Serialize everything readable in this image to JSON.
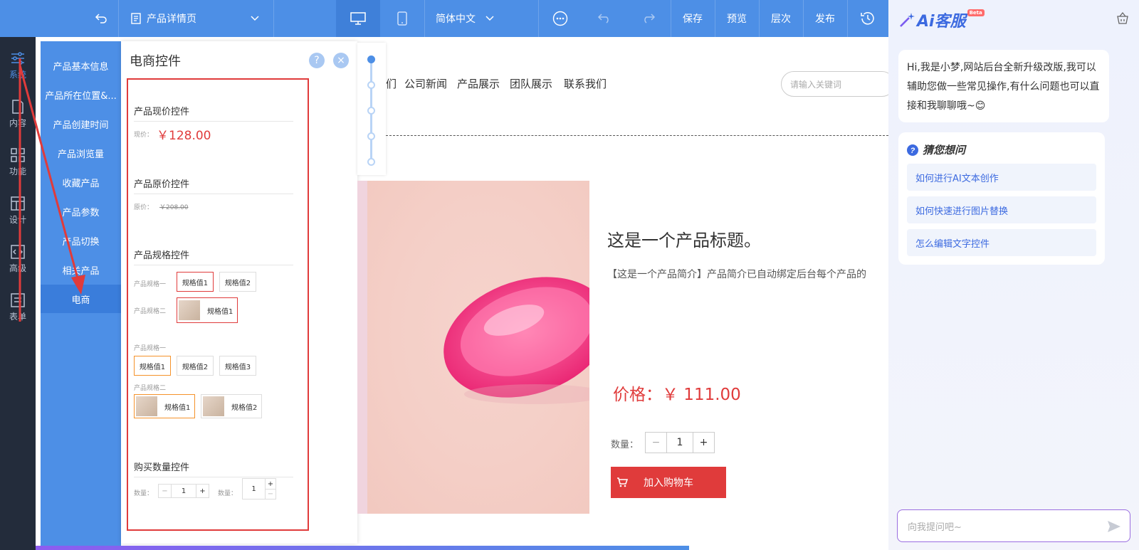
{
  "topbar": {
    "page_select": "产品详情页",
    "language": "简体中文",
    "save": "保存",
    "preview": "预览",
    "layers": "层次",
    "publish": "发布"
  },
  "rail": [
    {
      "label": "系统",
      "icon": "sliders-icon"
    },
    {
      "label": "内容",
      "icon": "document-icon"
    },
    {
      "label": "功能",
      "icon": "grid-icon"
    },
    {
      "label": "设计",
      "icon": "layout-icon"
    },
    {
      "label": "高级",
      "icon": "code-icon"
    },
    {
      "label": "表单",
      "icon": "form-icon"
    }
  ],
  "submenu": [
    "产品基本信息",
    "产品所在位置&...",
    "产品创建时间",
    "产品浏览量",
    "收藏产品",
    "产品参数",
    "产品切换",
    "相关产品",
    "电商"
  ],
  "panel": {
    "title": "电商控件",
    "help": "?",
    "close": "×",
    "sec_price_now": "产品现价控件",
    "lbl_now": "现价：",
    "price_now": "￥128.00",
    "sec_price_old": "产品原价控件",
    "lbl_old": "原价：",
    "price_old": "￥208.00",
    "sec_spec": "产品规格控件",
    "spec_a_label": "产品规格一",
    "spec_b_label": "产品规格二",
    "spec_val1": "规格值1",
    "spec_val2": "规格值2",
    "spec_val3": "规格值3",
    "sec_qty": "购买数量控件",
    "qty_label": "数量：",
    "qty_value": "1",
    "minus": "−",
    "plus": "+"
  },
  "site_nav": [
    "们",
    "公司新闻",
    "产品展示",
    "团队展示",
    "联系我们"
  ],
  "search_placeholder": "请输入关键词",
  "product": {
    "title": "这是一个产品标题。",
    "intro": "【这是一个产品简介】产品简介已自动绑定后台每个产品的",
    "price": "价格：￥ 111.00",
    "qty_label": "数量：",
    "qty_value": "1",
    "cart": "加入购物车"
  },
  "ai": {
    "brand": "Ai客服",
    "beta": "Beta",
    "greeting": "Hi,我是小梦,网站后台全新升级改版,我可以辅助您做一些常见操作,有什么问题也可以直接和我聊聊哦~😊",
    "guess_title": "猜您想问",
    "questions": [
      "如何进行AI文本创作",
      "如何快速进行图片替换",
      "怎么编辑文字控件"
    ],
    "input_placeholder": "向我提问吧~"
  },
  "progress_fraction": 0.8
}
